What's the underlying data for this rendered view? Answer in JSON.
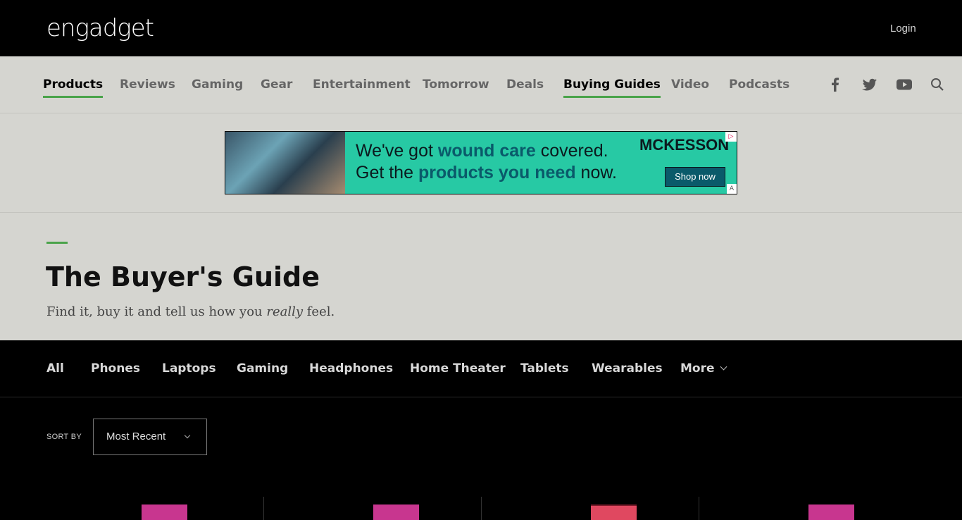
{
  "header": {
    "logo": "engadget",
    "login_label": "Login"
  },
  "mainnav": {
    "items": [
      {
        "label": "Products",
        "active": true
      },
      {
        "label": "Reviews"
      },
      {
        "label": "Gaming"
      },
      {
        "label": "Gear"
      },
      {
        "label": "Entertainment"
      },
      {
        "label": "Tomorrow"
      },
      {
        "label": "Deals"
      },
      {
        "label": "Buying Guides",
        "active": true
      },
      {
        "label": "Video"
      },
      {
        "label": "Podcasts"
      }
    ],
    "icons": [
      "facebook-icon",
      "twitter-icon",
      "youtube-icon",
      "search-icon"
    ]
  },
  "ad": {
    "line1_a": "We've got ",
    "line1_hl": "wound care",
    "line1_b": " covered.",
    "line2_a": "Get the ",
    "line2_hl": "products you need",
    "line2_b": " now.",
    "brand": "MCKESSON",
    "cta": "Shop now",
    "colors": {
      "bg": "#27c9a4",
      "accent": "#0a5a6a"
    }
  },
  "hero": {
    "title": "The Buyer's Guide",
    "subtitle_a": "Find it, buy it and tell us how you ",
    "subtitle_em": "really",
    "subtitle_b": " feel."
  },
  "categories": {
    "items": [
      "All",
      "Phones",
      "Laptops",
      "Gaming",
      "Headphones",
      "Home Theater",
      "Tablets",
      "Wearables"
    ],
    "more_label": "More"
  },
  "sort": {
    "label": "SORT BY",
    "value": "Most Recent"
  },
  "colors": {
    "accent_green": "#4aa34a",
    "nav_bg": "#d5d5d0",
    "thumb_magenta": "#c8368f",
    "thumb_red": "#e04860"
  }
}
